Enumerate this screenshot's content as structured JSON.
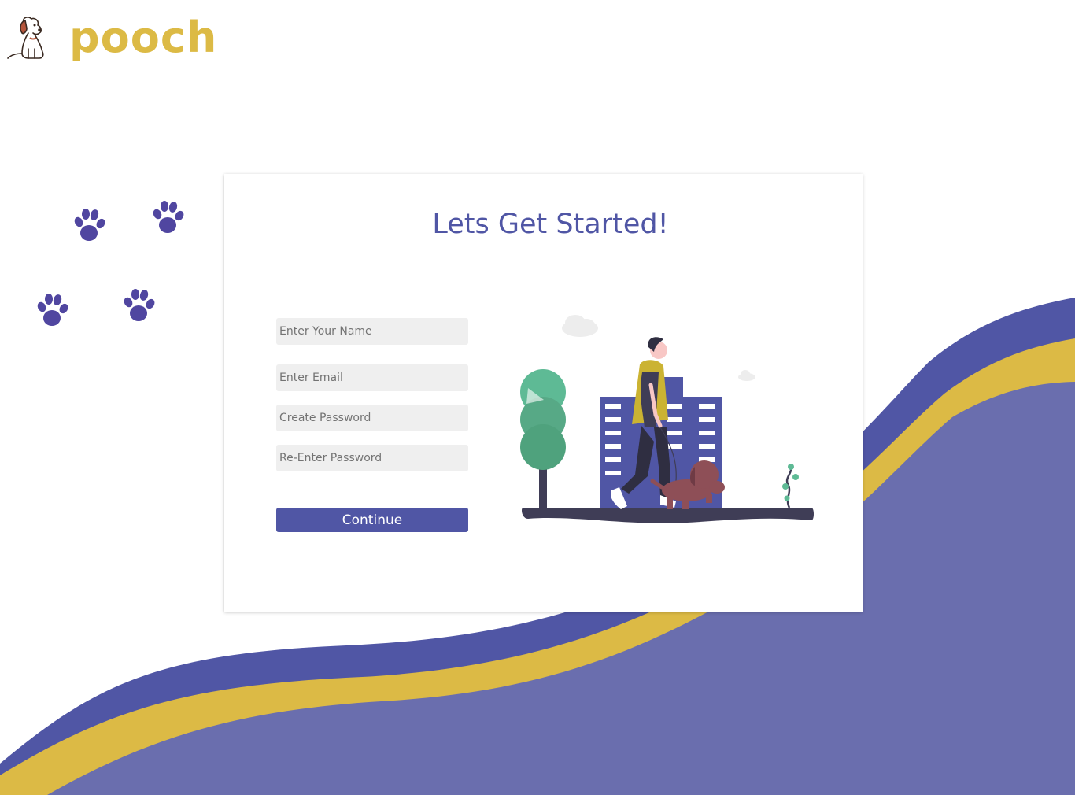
{
  "brand": {
    "name": "pooch",
    "logo_icon": "dog-logo-icon"
  },
  "colors": {
    "primary": "#5056A5",
    "accent": "#DCBA45",
    "field_bg": "#EFEFEF",
    "wave_fill": "#6A6EAE"
  },
  "paws": {
    "icon": "paw-print-icon",
    "count": 4
  },
  "signup": {
    "title": "Lets Get Started!",
    "name_placeholder": "Enter Your Name",
    "email_placeholder": "Enter Email",
    "password_placeholder": "Create Password",
    "confirm_placeholder": "Re-Enter Password",
    "continue_label": "Continue"
  },
  "illustration": {
    "icon": "man-walking-dog-illustration"
  }
}
